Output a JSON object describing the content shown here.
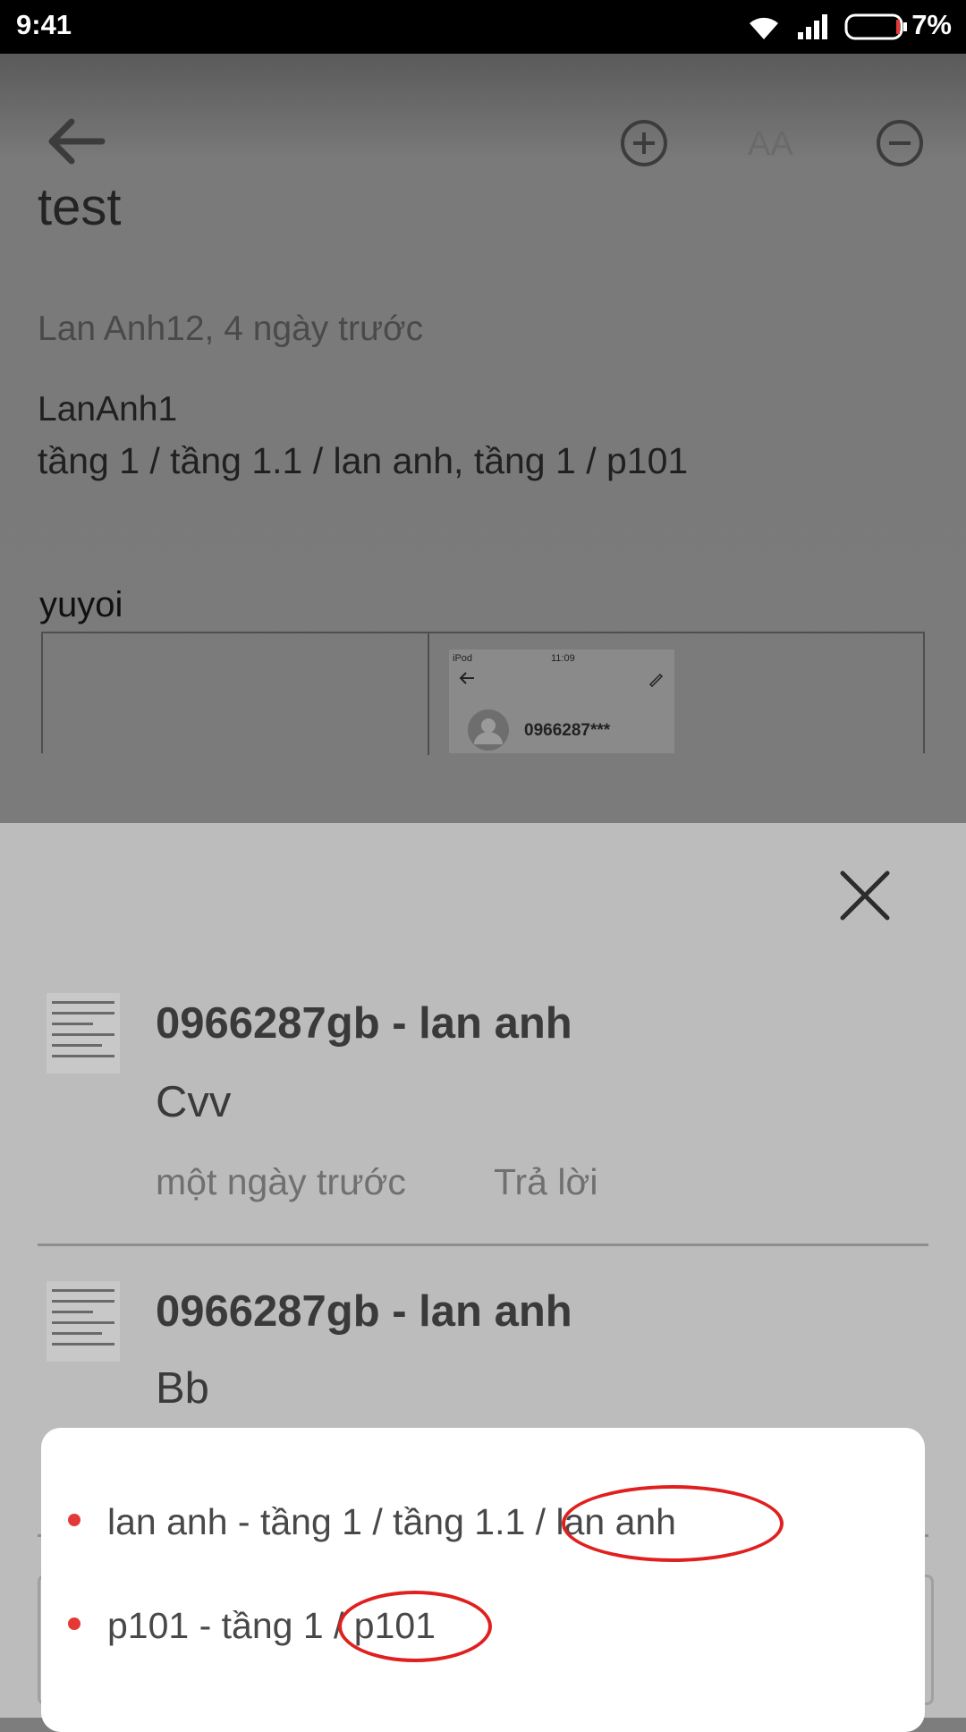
{
  "status_bar": {
    "time": "9:41",
    "battery": "7%"
  },
  "toolbar": {
    "back_icon": "arrow-left-icon",
    "zoom_in_icon": "plus-circle-icon",
    "font_size_label": "AA",
    "zoom_out_icon": "minus-circle-icon"
  },
  "article": {
    "title": "test",
    "meta": "Lan Anh12, 4 ngày trước",
    "author": "LanAnh1",
    "path": "tầng 1 / tầng 1.1 / lan anh, tầng 1 / p101",
    "body_text": "yuyoi",
    "embedded_screenshot": {
      "device": "iPod",
      "time": "11:09",
      "phone": "0966287***"
    }
  },
  "comments_sheet": {
    "close_icon": "close-icon",
    "comments": [
      {
        "author": "0966287gb - lan anh",
        "text": "Cvv",
        "time": "một ngày trước",
        "reply": "Trả lời"
      },
      {
        "author": "0966287gb - lan anh",
        "text": "Bb"
      }
    ]
  },
  "popup": {
    "items": [
      {
        "label": "lan anh - tầng 1 / tầng 1.1 / lan anh"
      },
      {
        "label": "p101 - tầng 1 / p101"
      }
    ],
    "accent_color": "#e53935"
  }
}
